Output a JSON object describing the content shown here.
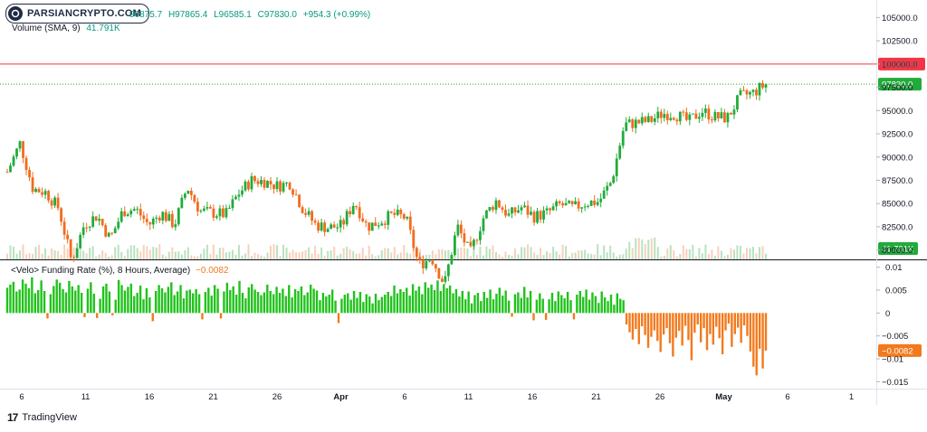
{
  "header": {
    "watermark": "PARSIANCRYPTO.COM",
    "ohlc": {
      "open": "96875.7",
      "high": "H97865.4",
      "low": "L96585.1",
      "close": "C97830.0",
      "change": "+954.3 (+0.99%)"
    },
    "volume_label": "Volume (SMA, 9)",
    "volume_value": "41.791K"
  },
  "funding_label": "<Velo> Funding Rate (%), 8 Hours, Average)",
  "funding_value": "−0.0082",
  "footer": {
    "brand": "TradingView"
  },
  "colors": {
    "up": "#089981",
    "down": "#f23645",
    "funding_pos": "#21c21c",
    "funding_neg": "#f27a1d",
    "resistance": "#f23645"
  },
  "chart_data": [
    {
      "type": "candlestick",
      "title": "",
      "y_ticks": [
        "105000.0",
        "102500.0",
        "100000.0",
        "97500.0",
        "95000.0",
        "92500.0",
        "90000.0",
        "87500.0",
        "85000.0",
        "82500.0",
        "80000.0"
      ],
      "ylim": [
        79000,
        106300
      ],
      "x_ticks": [
        "6",
        "11",
        "16",
        "21",
        "26",
        "Apr",
        "6",
        "11",
        "16",
        "21",
        "26",
        "May",
        "6",
        "1"
      ],
      "horizontal_line": {
        "value": 100000.0,
        "label": "100000.0"
      },
      "last_price": {
        "value": 97830.0,
        "label": "97830.0"
      },
      "close_path": [
        [
          "Mar 5",
          88400
        ],
        [
          "Mar 6",
          91500
        ],
        [
          "Mar 7",
          86600
        ],
        [
          "Mar 8",
          86200
        ],
        [
          "Mar 9",
          84500
        ],
        [
          "Mar 10",
          78800
        ],
        [
          "Mar 11",
          82800
        ],
        [
          "Mar 12",
          83700
        ],
        [
          "Mar 13",
          81200
        ],
        [
          "Mar 14",
          84200
        ],
        [
          "Mar 15",
          84400
        ],
        [
          "Mar 16",
          82700
        ],
        [
          "Mar 17",
          84000
        ],
        [
          "Mar 18",
          82700
        ],
        [
          "Mar 19",
          86800
        ],
        [
          "Mar 20",
          84200
        ],
        [
          "Mar 21",
          84000
        ],
        [
          "Mar 22",
          83800
        ],
        [
          "Mar 23",
          86100
        ],
        [
          "Mar 24",
          87500
        ],
        [
          "Mar 25",
          87400
        ],
        [
          "Mar 26",
          86900
        ],
        [
          "Mar 27",
          87200
        ],
        [
          "Mar 28",
          84400
        ],
        [
          "Mar 29",
          82700
        ],
        [
          "Mar 30",
          82400
        ],
        [
          "Mar 31",
          82600
        ],
        [
          "Apr 1",
          85200
        ],
        [
          "Apr 2",
          82500
        ],
        [
          "Apr 3",
          83100
        ],
        [
          "Apr 4",
          83800
        ],
        [
          "Apr 5",
          83500
        ],
        [
          "Apr 6",
          78400
        ],
        [
          "Apr 7",
          79200
        ],
        [
          "Apr 8",
          76300
        ],
        [
          "Apr 9",
          82600
        ],
        [
          "Apr 10",
          79600
        ],
        [
          "Apr 11",
          83400
        ],
        [
          "Apr 12",
          85300
        ],
        [
          "Apr 13",
          83700
        ],
        [
          "Apr 14",
          84600
        ],
        [
          "Apr 15",
          83600
        ],
        [
          "Apr 16",
          84000
        ],
        [
          "Apr 17",
          84900
        ],
        [
          "Apr 18",
          84500
        ],
        [
          "Apr 19",
          85100
        ],
        [
          "Apr 20",
          85200
        ],
        [
          "Apr 21",
          87400
        ],
        [
          "Apr 22",
          93500
        ],
        [
          "Apr 23",
          93700
        ],
        [
          "Apr 24",
          93900
        ],
        [
          "Apr 25",
          94700
        ],
        [
          "Apr 26",
          94600
        ],
        [
          "Apr 27",
          93800
        ],
        [
          "Apr 28",
          95000
        ],
        [
          "Apr 29",
          94300
        ],
        [
          "Apr 30",
          94200
        ],
        [
          "May 1",
          96500
        ],
        [
          "May 2",
          96900
        ],
        [
          "May 3",
          97830
        ]
      ],
      "volume_last": "41.791K"
    },
    {
      "type": "bar",
      "title": "<Velo> Funding Rate (%), 8 Hours, Average)",
      "y_ticks": [
        "0.01",
        "0.005",
        "0",
        "−0.005",
        "−0.01",
        "−0.015"
      ],
      "ylim": [
        -0.0165,
        0.0115
      ],
      "last_value": {
        "value": -0.0082,
        "label": "−0.0082"
      },
      "values": [
        0.0055,
        0.0062,
        0.0068,
        0.0047,
        0.0051,
        0.0073,
        0.0064,
        0.0054,
        0.0078,
        0.0043,
        0.005,
        0.0071,
        0.0048,
        -0.0012,
        0.0041,
        0.0059,
        0.0073,
        0.0066,
        0.0052,
        0.0045,
        0.007,
        0.0058,
        0.0049,
        0.0061,
        0.0044,
        -0.0009,
        0.0053,
        0.0067,
        0.0042,
        -0.0011,
        0.0031,
        0.0058,
        0.0064,
        0.0047,
        -0.0005,
        0.0029,
        0.0072,
        0.0061,
        0.0049,
        0.0057,
        0.0064,
        0.0037,
        0.0044,
        0.006,
        0.003,
        0.0054,
        0.0034,
        -0.0018,
        0.0048,
        0.0061,
        0.0054,
        0.0045,
        0.0057,
        0.0067,
        0.0039,
        0.0047,
        0.0061,
        0.0032,
        0.0049,
        0.0051,
        0.0043,
        0.0052,
        0.0041,
        -0.0014,
        0.0046,
        0.0055,
        0.0038,
        0.0061,
        0.0053,
        -0.0012,
        0.0047,
        0.0066,
        0.005,
        0.0058,
        0.004,
        0.007,
        0.0044,
        0.0032,
        0.0056,
        0.0063,
        0.0051,
        0.0046,
        0.0039,
        0.0045,
        0.0062,
        0.0048,
        0.0041,
        0.0057,
        0.0044,
        0.0053,
        0.0037,
        0.0061,
        0.0034,
        0.0052,
        0.0048,
        0.0058,
        0.0039,
        0.0045,
        0.0062,
        0.0053,
        0.0049,
        0.0028,
        0.0044,
        0.0036,
        0.004,
        0.0051,
        0.0027,
        -0.0022,
        0.0031,
        0.004,
        0.0043,
        0.0029,
        0.0048,
        0.0033,
        0.0046,
        0.0024,
        0.0041,
        0.0036,
        0.0021,
        0.0042,
        0.0028,
        0.0035,
        0.004,
        0.0046,
        0.0037,
        0.006,
        0.0043,
        0.0052,
        0.0046,
        0.0055,
        0.0038,
        0.0063,
        0.0049,
        0.0058,
        0.0041,
        0.0067,
        0.0055,
        0.0062,
        0.005,
        0.0071,
        0.0048,
        0.0063,
        0.0054,
        0.006,
        0.0043,
        0.0052,
        0.0036,
        0.0048,
        0.003,
        0.0047,
        0.0021,
        0.0039,
        0.0044,
        0.0026,
        0.0046,
        0.0033,
        0.0051,
        0.003,
        0.0042,
        0.0055,
        0.0038,
        0.0049,
        0.0027,
        -0.0008,
        0.0041,
        0.0045,
        0.0033,
        0.0057,
        0.0034,
        0.0048,
        -0.0016,
        0.0029,
        0.0043,
        0.0031,
        -0.0015,
        0.003,
        0.0044,
        0.0026,
        0.0047,
        0.0039,
        0.0032,
        0.0046,
        0.0028,
        -0.0014,
        0.004,
        0.0048,
        0.0035,
        0.0051,
        0.0029,
        0.0045,
        0.0037,
        0.0022,
        0.0047,
        0.0034,
        0.0026,
        0.004,
        0.0018,
        0.0043,
        0.0031,
        0.0028,
        -0.0025,
        -0.0042,
        -0.0058,
        -0.0035,
        -0.0068,
        -0.0029,
        -0.0048,
        -0.0076,
        -0.0052,
        -0.0038,
        -0.0061,
        -0.0085,
        -0.0047,
        -0.0033,
        -0.0066,
        -0.0095,
        -0.0054,
        -0.0039,
        -0.0071,
        -0.0028,
        -0.0059,
        -0.0103,
        -0.0043,
        -0.0025,
        -0.0064,
        -0.0033,
        -0.0081,
        -0.0046,
        -0.0069,
        -0.003,
        -0.0055,
        -0.009,
        -0.0038,
        -0.0023,
        -0.0074,
        -0.0046,
        -0.0032,
        -0.0065,
        -0.0027,
        -0.005,
        -0.0084,
        -0.0117,
        -0.0136,
        -0.0078,
        -0.0121,
        -0.0082
      ]
    }
  ]
}
